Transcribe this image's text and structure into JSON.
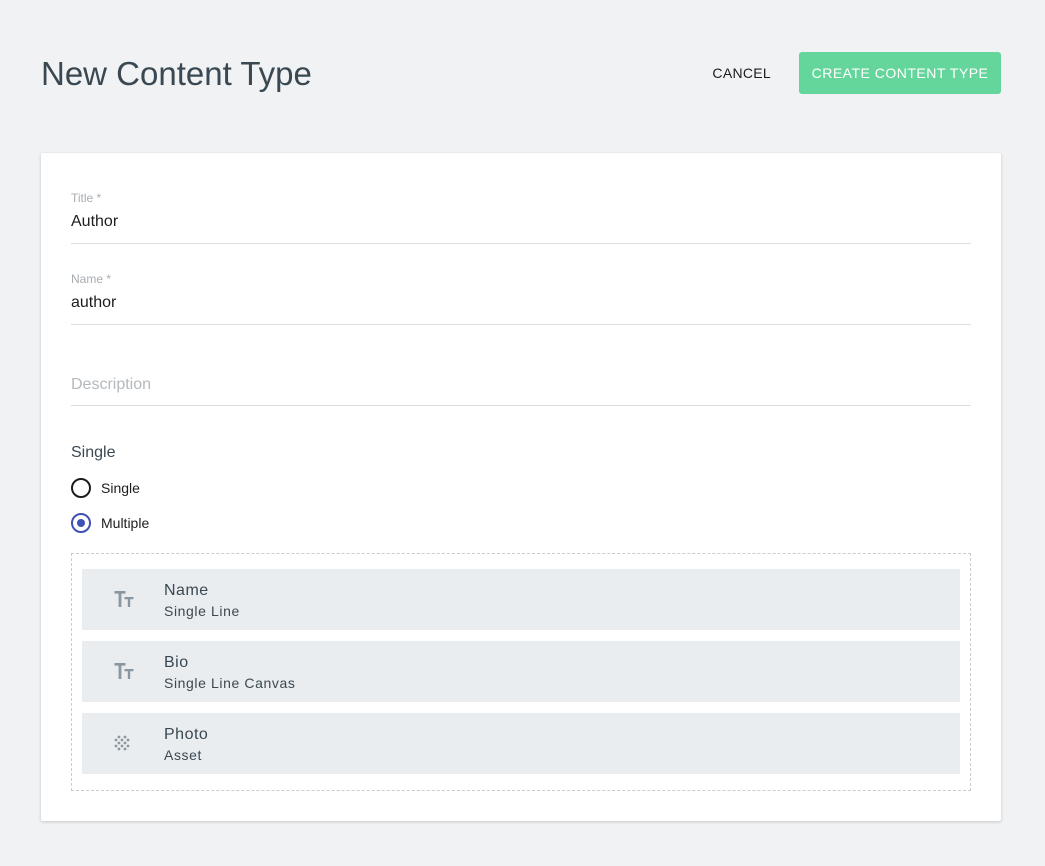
{
  "header": {
    "title": "New Content Type",
    "cancel_label": "CANCEL",
    "create_label": "CREATE CONTENT TYPE"
  },
  "form": {
    "title_field": {
      "label": "Title *",
      "value": "Author"
    },
    "name_field": {
      "label": "Name *",
      "value": "author"
    },
    "description_field": {
      "placeholder": "Description",
      "value": ""
    },
    "cardinality": {
      "label": "Single",
      "options": [
        {
          "label": "Single",
          "selected": false
        },
        {
          "label": "Multiple",
          "selected": true
        }
      ]
    }
  },
  "fields": [
    {
      "name": "Name",
      "type": "Single Line",
      "icon": "text-format-icon"
    },
    {
      "name": "Bio",
      "type": "Single Line Canvas",
      "icon": "text-format-icon"
    },
    {
      "name": "Photo",
      "type": "Asset",
      "icon": "asset-dots-icon"
    }
  ],
  "colors": {
    "primary": "#65d69b",
    "radio_accent": "#3f51b5",
    "background": "#f0f2f4",
    "row_background": "#eaedf0",
    "icon": "#8a97a0"
  }
}
